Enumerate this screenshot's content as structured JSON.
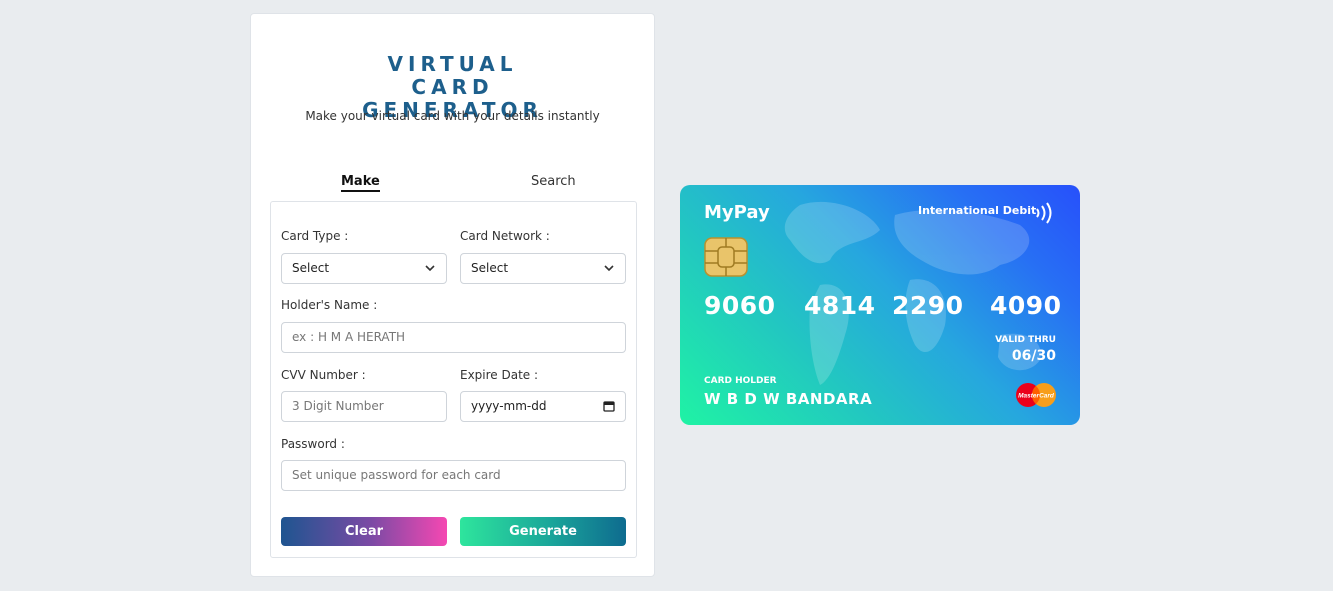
{
  "header": {
    "title": "VIRTUAL CARD GENERATOR",
    "subtitle": "Make your virtual card with your details instantly"
  },
  "tabs": [
    {
      "label": "Make",
      "active": true
    },
    {
      "label": "Search",
      "active": false
    }
  ],
  "form": {
    "card_type": {
      "label": "Card Type :",
      "value": "Select"
    },
    "card_network": {
      "label": "Card Network :",
      "value": "Select"
    },
    "holder_name": {
      "label": "Holder's Name :",
      "placeholder": "ex : H M A HERATH"
    },
    "cvv": {
      "label": "CVV Number :",
      "placeholder": "3 Digit Number"
    },
    "expire": {
      "label": "Expire Date :",
      "placeholder": "yyyy-mm-dd"
    },
    "password": {
      "label": "Password :",
      "placeholder": "Set unique password for each card"
    },
    "clear_label": "Clear",
    "generate_label": "Generate"
  },
  "card": {
    "brand": "MyPay",
    "type_label": "International Debit",
    "number_groups": [
      "9060",
      "4814",
      "2290",
      "4090"
    ],
    "valid_label": "VALID THRU",
    "valid_value": "06/30",
    "holder_label": "CARD HOLDER",
    "holder_name": "W B D W BANDARA",
    "network_logo_text": "MasterCard",
    "icons": [
      "chip-icon",
      "contactless-icon",
      "mastercard-logo"
    ],
    "colors": {
      "gradient_start": "#1ff3a4",
      "gradient_end": "#2750fb"
    }
  },
  "colors": {
    "title": "#1d5f8c",
    "background": "#e9ecef",
    "clear_gradient": [
      "#1e5590",
      "#f548b2"
    ],
    "generate_gradient": [
      "#2ee59d",
      "#0e6b8f"
    ]
  }
}
